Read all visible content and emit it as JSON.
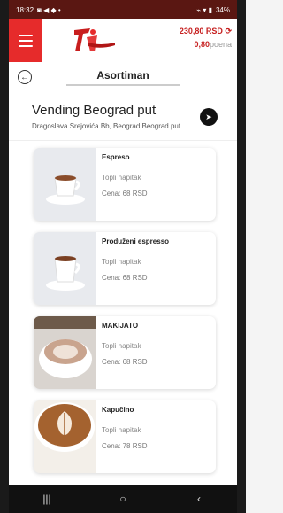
{
  "status": {
    "time": "18:32",
    "icons_left": "◙ ◀ ◆ •",
    "icons_right": "⌁ ▾ ▮",
    "battery": "34%"
  },
  "header": {
    "balance_amount": "230,80 RSD",
    "points_amount": "0,80",
    "points_unit": "poena"
  },
  "page": {
    "title": "Asortiman"
  },
  "location": {
    "name": "Vending Beograd put",
    "address": "Dragoslava Srejovića Bb, Beograd Beograd put"
  },
  "products": [
    {
      "name": "Espreso",
      "category": "Topli napitak",
      "price": "Cena: 68 RSD"
    },
    {
      "name": "Produženi espresso",
      "category": "Topli napitak",
      "price": "Cena: 68 RSD"
    },
    {
      "name": "MAKIJATO",
      "category": "Topli napitak",
      "price": "Cena: 68 RSD"
    },
    {
      "name": "Kapučino",
      "category": "Topli napitak",
      "price": "Cena: 78 RSD"
    }
  ],
  "colors": {
    "accent": "#e62b2b",
    "status_bar": "#5a1712",
    "price_red": "#c62020"
  },
  "navbar": {
    "recent": "|||",
    "home": "○",
    "back": "‹"
  }
}
